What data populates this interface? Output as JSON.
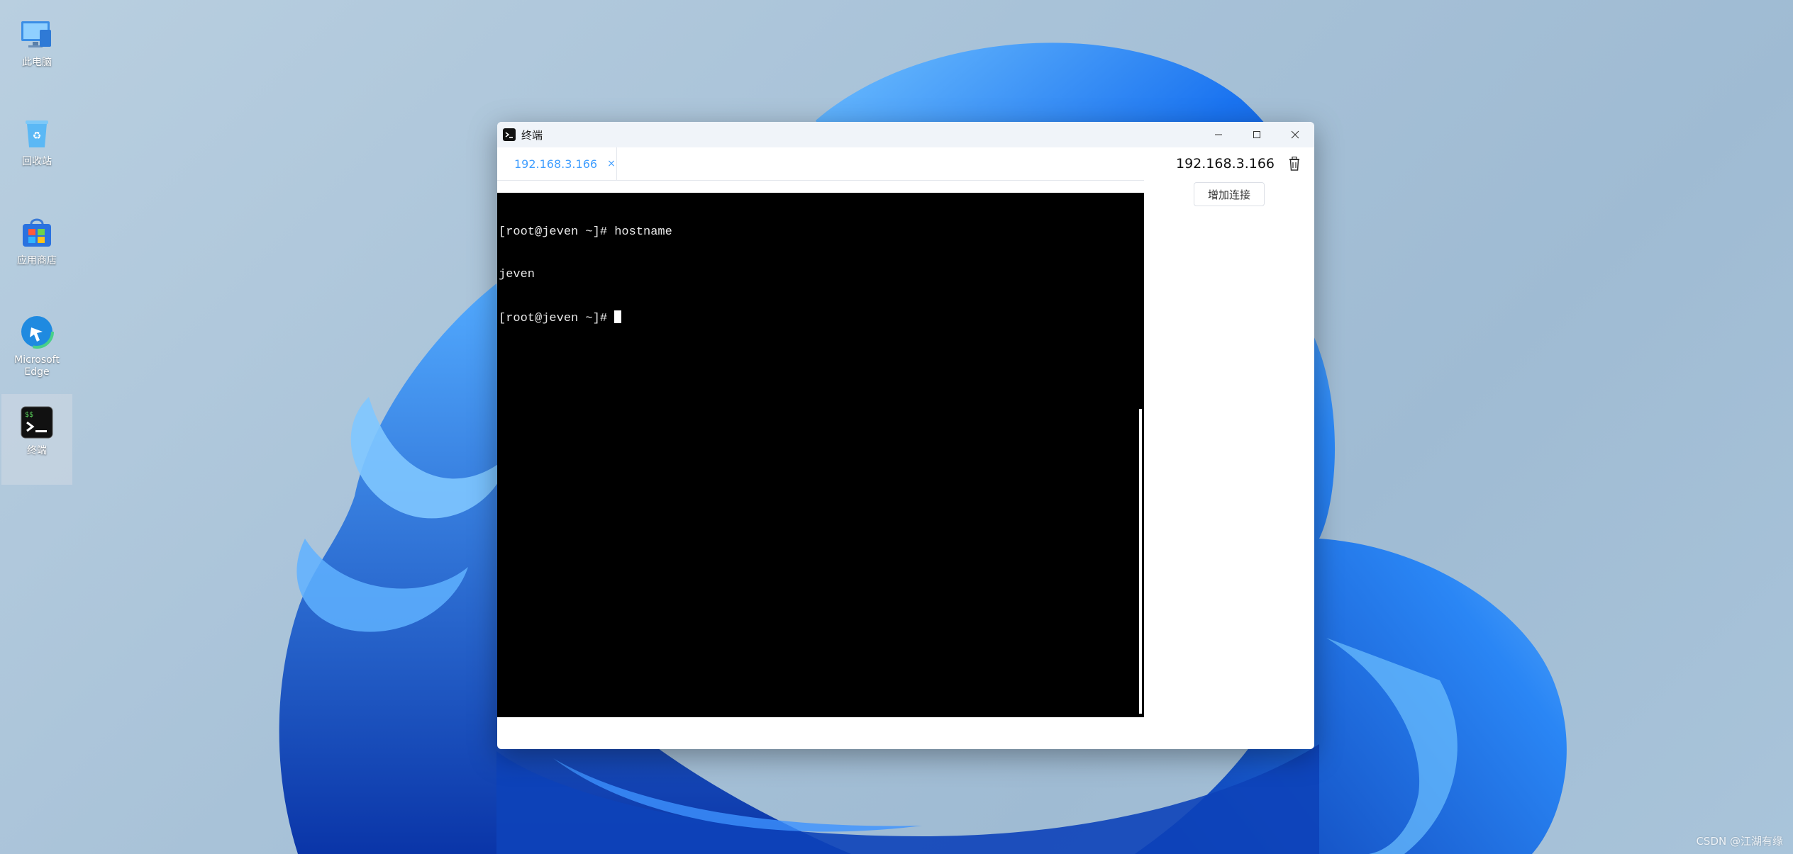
{
  "desktop": {
    "icons": [
      {
        "label": "此电脑",
        "icon": "computer-icon"
      },
      {
        "label": "回收站",
        "icon": "recycle-bin-icon"
      },
      {
        "label": "应用商店",
        "icon": "store-icon"
      },
      {
        "label": "Microsoft\nEdge",
        "icon": "edge-icon"
      },
      {
        "label": "终端",
        "icon": "terminal-icon",
        "selected": true
      }
    ],
    "watermark": "CSDN @江湖有缘"
  },
  "window": {
    "title": "终端",
    "controls": [
      "minimize",
      "maximize",
      "close"
    ],
    "tabs": [
      {
        "label": "192.168.3.166",
        "close": "×",
        "active": true
      }
    ],
    "terminal": {
      "lines": [
        "[root@jeven ~]# hostname",
        "jeven",
        "[root@jeven ~]# "
      ]
    },
    "side": {
      "host": "192.168.3.166",
      "add_connection": "增加连接"
    }
  },
  "colors": {
    "accent": "#409eff",
    "terminal_bg": "#000000",
    "titlebar_bg": "#f0f4f9"
  }
}
